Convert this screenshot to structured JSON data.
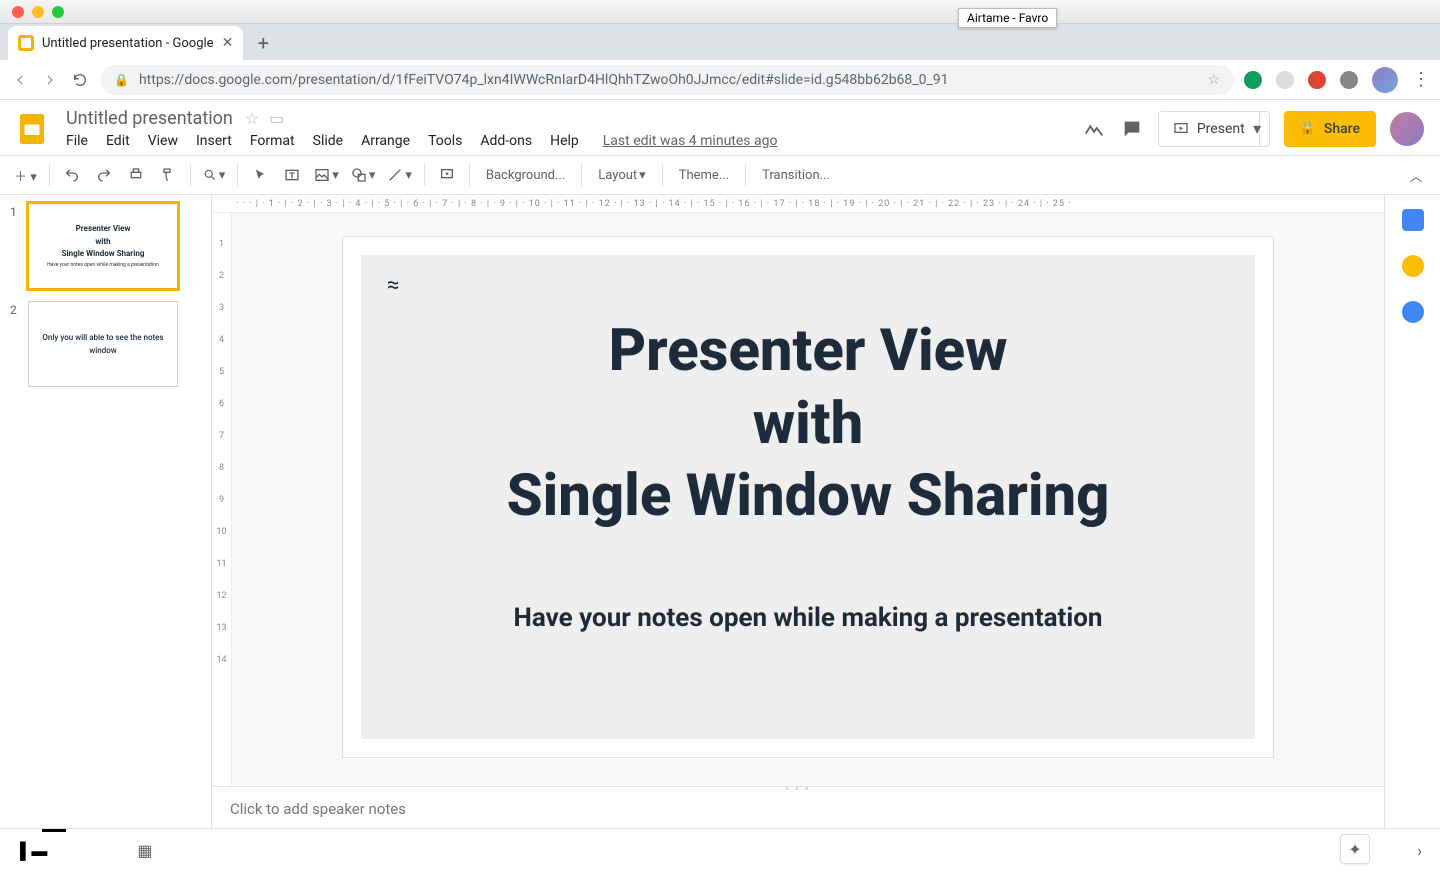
{
  "mac": {
    "tooltip": "Airtame - Favro"
  },
  "browser": {
    "tab_title": "Untitled presentation - Google",
    "url": "https://docs.google.com/presentation/d/1fFeiTVO74p_lxn4IWWcRnIarD4HlQhhTZwoOh0JJmcc/edit#slide=id.g548bb62b68_0_91"
  },
  "docs": {
    "title": "Untitled presentation",
    "menu": {
      "file": "File",
      "edit": "Edit",
      "view": "View",
      "insert": "Insert",
      "format": "Format",
      "slide": "Slide",
      "arrange": "Arrange",
      "tools": "Tools",
      "addons": "Add-ons",
      "help": "Help",
      "lastedit": "Last edit was 4 minutes ago"
    },
    "present_label": "Present",
    "share_label": "Share"
  },
  "toolbar": {
    "background": "Background...",
    "layout": "Layout",
    "theme": "Theme...",
    "transition": "Transition..."
  },
  "ruler_h": "· · · | · 1 · | · 2 · | · 3 · | · 4 · | · 5 · | · 6 · | · 7 · | · 8 · | · 9 · | · 10 · | · 11 · | · 12 · | · 13 · | · 14 · | · 15 · | · 16 · | · 17 · | · 18 · | · 19 · | · 20 · | · 21 · | · 22 · | · 23 · | · 24 · | · 25 ·",
  "ruler_v": [
    "",
    "1",
    "2",
    "3",
    "4",
    "5",
    "6",
    "7",
    "8",
    "9",
    "10",
    "11",
    "12",
    "13",
    "14"
  ],
  "filmstrip": {
    "s1": {
      "num": "1",
      "l1": "Presenter View",
      "l2": "with",
      "l3": "Single Window Sharing",
      "sub": "Have your notes open while making a presentation"
    },
    "s2": {
      "num": "2",
      "l1": "Only you will able to see the notes",
      "l2": "window"
    }
  },
  "slide": {
    "approx": "≈",
    "h1": "Presenter View",
    "h2": "with",
    "h3": "Single Window Sharing",
    "sub": "Have your notes open while making a presentation"
  },
  "notes_placeholder": "Click to add speaker notes"
}
